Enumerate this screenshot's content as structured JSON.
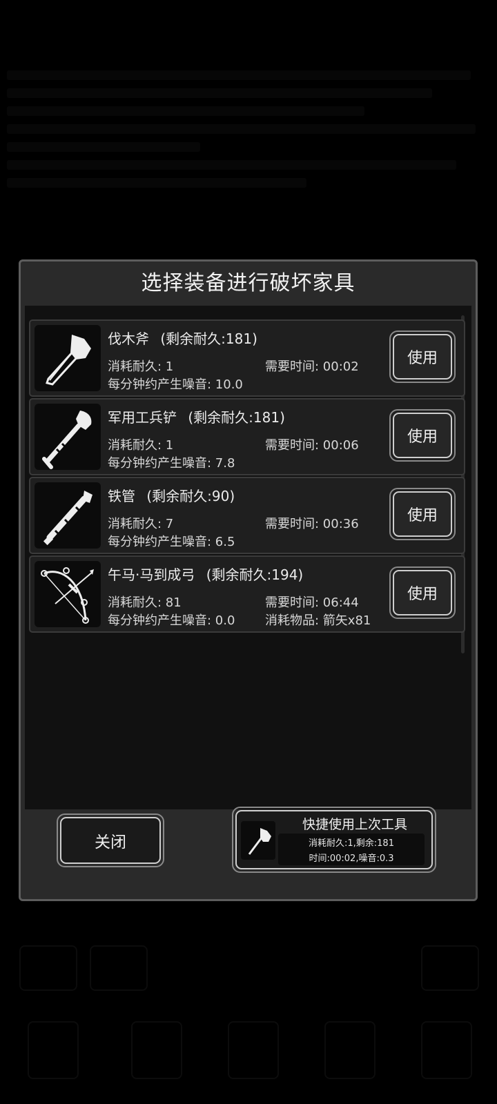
{
  "dialog": {
    "title": "选择装备进行破坏家具"
  },
  "items": [
    {
      "name": "伐木斧",
      "durability_text": "(剩余耐久:181)",
      "icon": "axe-icon",
      "cost": "消耗耐久: 1",
      "time": "需要时间: 00:02",
      "noise": "每分钟约产生噪音: 10.0",
      "extra": "",
      "use_label": "使用"
    },
    {
      "name": "军用工兵铲",
      "durability_text": "(剩余耐久:181)",
      "icon": "shovel-icon",
      "cost": "消耗耐久: 1",
      "time": "需要时间: 00:06",
      "noise": "每分钟约产生噪音: 7.8",
      "extra": "",
      "use_label": "使用"
    },
    {
      "name": "铁管",
      "durability_text": "(剩余耐久:90)",
      "icon": "pipe-icon",
      "cost": "消耗耐久: 7",
      "time": "需要时间: 00:36",
      "noise": "每分钟约产生噪音: 6.5",
      "extra": "",
      "use_label": "使用"
    },
    {
      "name": "午马·马到成弓",
      "durability_text": "(剩余耐久:194)",
      "icon": "bow-icon",
      "cost": "消耗耐久: 81",
      "time": "需要时间: 06:44",
      "noise": "每分钟约产生噪音: 0.0",
      "extra": "消耗物品: 箭矢x81",
      "use_label": "使用"
    }
  ],
  "footer": {
    "close_label": "关闭",
    "quick_title": "快捷使用上次工具",
    "quick_line1": "消耗耐久:1,剩余:181",
    "quick_line2": "时间:00:02,噪音:0.3",
    "quick_icon": "axe-icon"
  }
}
